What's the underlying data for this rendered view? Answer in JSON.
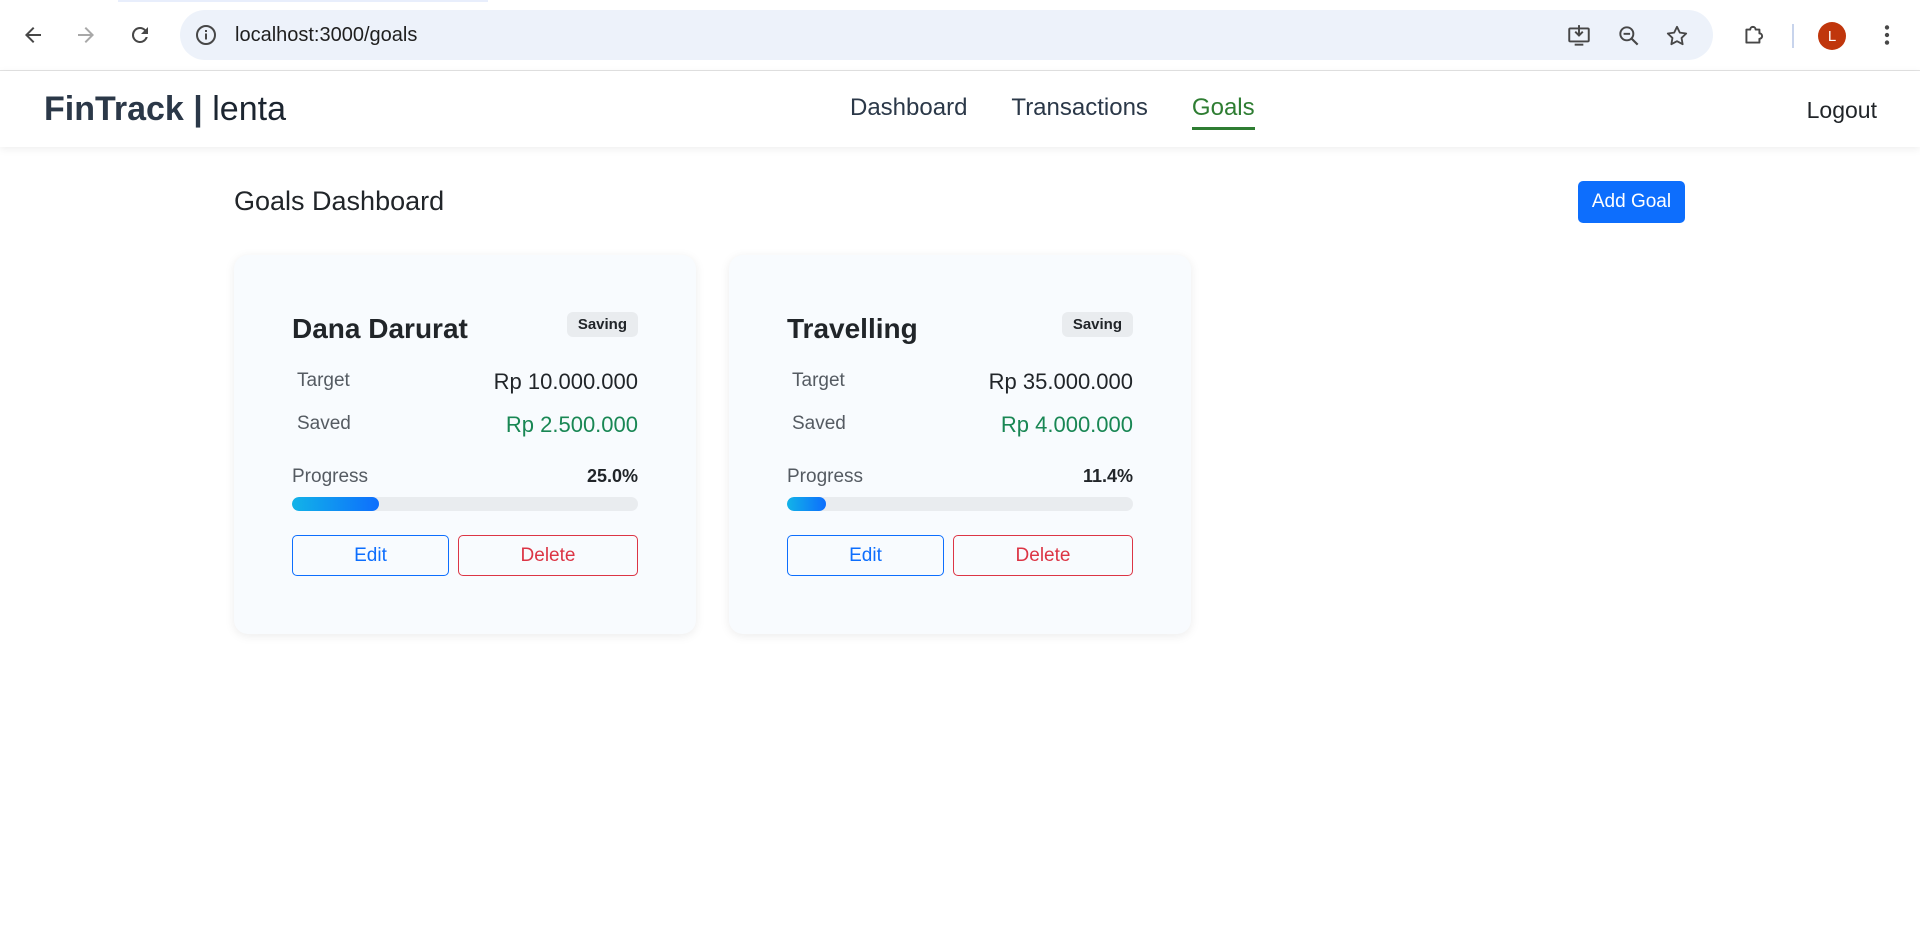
{
  "browser": {
    "url": "localhost:3000/goals",
    "avatar_letter": "L",
    "avatar_color": "#c0360c"
  },
  "navbar": {
    "brand": "FinTrack | ",
    "brand_user": "lenta",
    "links": [
      {
        "label": "Dashboard",
        "active": false
      },
      {
        "label": "Transactions",
        "active": false
      },
      {
        "label": "Goals",
        "active": true
      }
    ],
    "logout_label": "Logout",
    "active_color": "#2e7d32"
  },
  "main": {
    "title": "Goals Dashboard",
    "add_goal_label": "Add Goal"
  },
  "goals": [
    {
      "name": "Dana Darurat",
      "badge": "Saving",
      "target_label": "Target",
      "target_value": "Rp 10.000.000",
      "saved_label": "Saved",
      "saved_value": "Rp 2.500.000",
      "progress_label": "Progress",
      "progress_text": "25.0%",
      "progress_fraction": 0.25,
      "edit_label": "Edit",
      "delete_label": "Delete"
    },
    {
      "name": "Travelling",
      "badge": "Saving",
      "target_label": "Target",
      "target_value": "Rp 35.000.000",
      "saved_label": "Saved",
      "saved_value": "Rp 4.000.000",
      "progress_label": "Progress",
      "progress_text": "11.4%",
      "progress_fraction": 0.114,
      "edit_label": "Edit",
      "delete_label": "Delete"
    }
  ]
}
